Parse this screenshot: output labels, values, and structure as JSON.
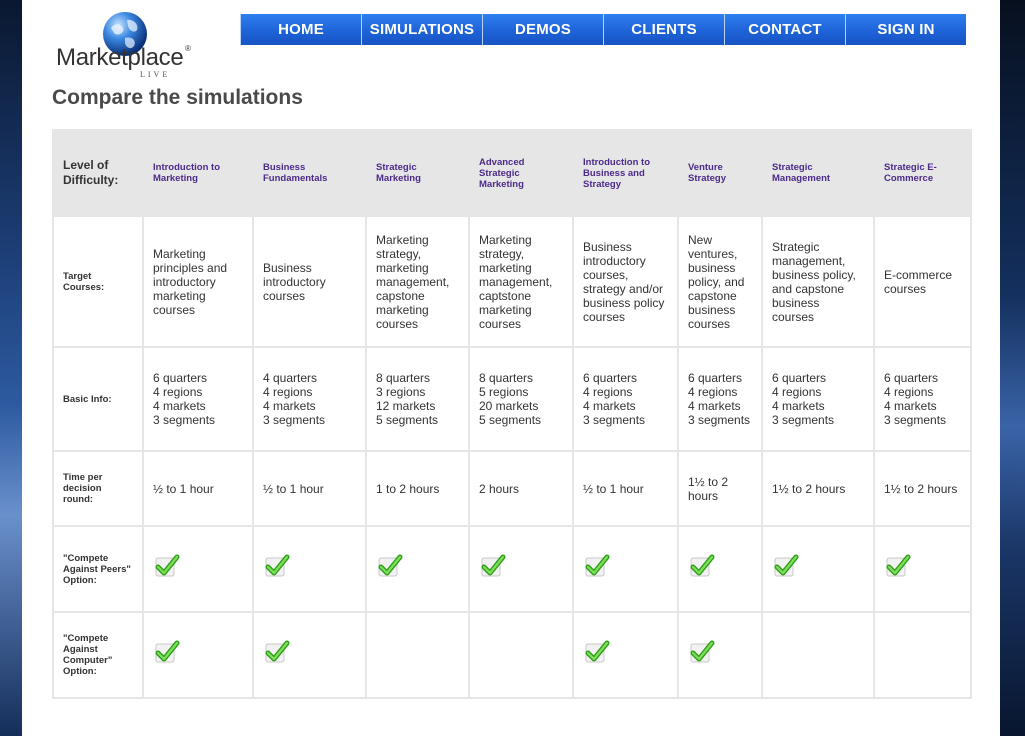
{
  "nav": {
    "items": [
      {
        "label": "HOME"
      },
      {
        "label": "SIMULATIONS"
      },
      {
        "label": "DEMOS"
      },
      {
        "label": "CLIENTS"
      },
      {
        "label": "CONTACT"
      },
      {
        "label": "SIGN IN"
      }
    ],
    "color": "#1e63d8"
  },
  "logo": {
    "brand": "Marketplace",
    "registered": "®",
    "subtitle": "LIVE"
  },
  "page": {
    "title": "Compare the simulations"
  },
  "table": {
    "corner_label": "Level of Difficulty:",
    "columns": [
      "Introduction to Marketing",
      "Business Fundamentals",
      "Strategic Marketing",
      "Advanced Strategic Marketing",
      "Introduction to Business and Strategy",
      "Venture Strategy",
      "Strategic Management",
      "Strategic E-Commerce"
    ],
    "rows": [
      {
        "label": "Target Courses:",
        "type": "text",
        "cells": [
          "Marketing principles and introductory marketing courses",
          "Business introductory courses",
          "Marketing strategy, marketing management, capstone marketing courses",
          "Marketing strategy, marketing management, captstone marketing courses",
          "Business introductory courses, strategy and/or business policy courses",
          "New ventures, business policy, and capstone business courses",
          "Strategic management, business policy, and capstone business courses",
          "E-commerce courses"
        ]
      },
      {
        "label": "Basic Info:",
        "type": "lines",
        "cells": [
          [
            "6 quarters",
            "4 regions",
            "4 markets",
            "3 segments"
          ],
          [
            "4 quarters",
            "4 regions",
            "4 markets",
            "3 segments"
          ],
          [
            "8 quarters",
            "3 regions",
            "12 markets",
            "5 segments"
          ],
          [
            "8 quarters",
            "5 regions",
            "20 markets",
            "5 segments"
          ],
          [
            "6 quarters",
            "4 regions",
            "4 markets",
            "3 segments"
          ],
          [
            "6 quarters",
            "4 regions",
            "4 markets",
            "3 segments"
          ],
          [
            "6 quarters",
            "4 regions",
            "4 markets",
            "3 segments"
          ],
          [
            "6 quarters",
            "4 regions",
            "4 markets",
            "3 segments"
          ]
        ]
      },
      {
        "label": "Time per decision round:",
        "type": "text",
        "cells": [
          "½ to 1 hour",
          "½ to 1 hour",
          "1 to 2 hours",
          "2 hours",
          "½ to 1 hour",
          "1½ to 2 hours",
          "1½ to 2 hours",
          "1½ to 2 hours"
        ]
      },
      {
        "label": "\"Compete Against Peers\" Option:",
        "type": "check",
        "cells": [
          true,
          true,
          true,
          true,
          true,
          true,
          true,
          true
        ]
      },
      {
        "label": "\"Compete Against Computer\" Option:",
        "type": "check",
        "cells": [
          true,
          true,
          false,
          false,
          true,
          true,
          false,
          false
        ]
      }
    ],
    "check_icon": "green-checkmark-icon",
    "header_color": "#4b2a8a"
  }
}
